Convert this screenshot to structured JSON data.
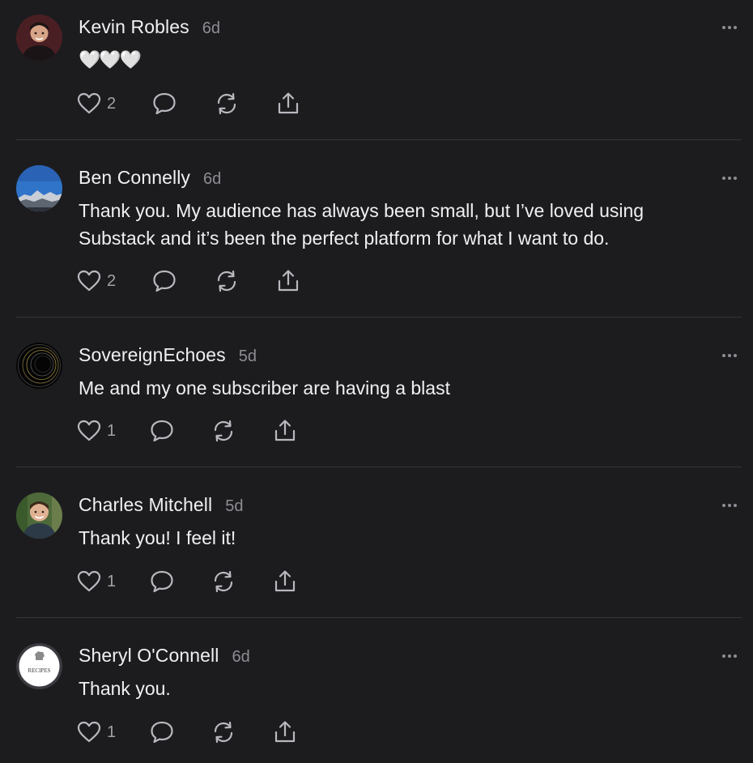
{
  "comments": [
    {
      "author": "Kevin Robles",
      "time": "6d",
      "text": "🤍🤍🤍",
      "likes": "2",
      "avatar_icon": "person-photo-icon"
    },
    {
      "author": "Ben Connelly",
      "time": "6d",
      "text": "Thank you. My audience has always been small, but I’ve loved using Substack and it’s been the perfect platform for what I want to do.",
      "likes": "2",
      "avatar_icon": "mountain-landscape-icon"
    },
    {
      "author": "SovereignEchoes",
      "time": "5d",
      "text": "Me and my one subscriber are having a blast",
      "likes": "1",
      "avatar_icon": "black-rings-icon"
    },
    {
      "author": "Charles Mitchell",
      "time": "5d",
      "text": "Thank you! I feel it!",
      "likes": "1",
      "avatar_icon": "person-photo-icon"
    },
    {
      "author": "Sheryl O'Connell",
      "time": "6d",
      "text": "Thank you.",
      "likes": "1",
      "avatar_icon": "recipes-logo-icon",
      "avatar_logo_text": "RECIPES"
    }
  ],
  "icons": {
    "like": "heart-icon",
    "reply": "comment-bubble-icon",
    "restack": "restack-icon",
    "share": "share-icon",
    "more": "more-options-icon"
  },
  "colors": {
    "background": "#1c1c1f",
    "text": "#f0f0f2",
    "muted": "#8d8d93",
    "divider": "#34343a"
  }
}
